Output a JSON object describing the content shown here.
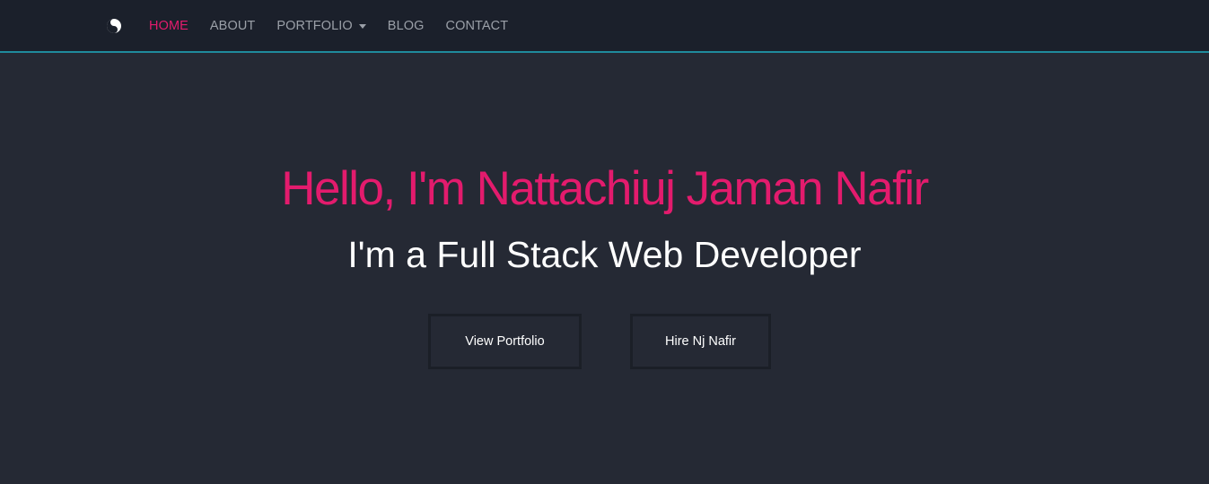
{
  "nav": {
    "logo_icon": "yin-yang-logo-icon",
    "items": [
      {
        "label": "HOME",
        "active": true
      },
      {
        "label": "ABOUT",
        "active": false
      },
      {
        "label": "PORTFOLIO",
        "active": false,
        "dropdown": true
      },
      {
        "label": "BLOG",
        "active": false
      },
      {
        "label": "CONTACT",
        "active": false
      }
    ]
  },
  "hero": {
    "title": "Hello, I'm Nattachiuj Jaman Nafir",
    "subtitle": "I'm a Full Stack Web Developer",
    "buttons": {
      "portfolio": "View Portfolio",
      "hire": "Hire Nj Nafir"
    }
  },
  "colors": {
    "background": "#252934",
    "navbar": "#1b202b",
    "navbar_border": "#1f8b9c",
    "accent": "#e31b6d",
    "nav_text": "#9ba0a8",
    "button_border": "#1b1f27"
  }
}
